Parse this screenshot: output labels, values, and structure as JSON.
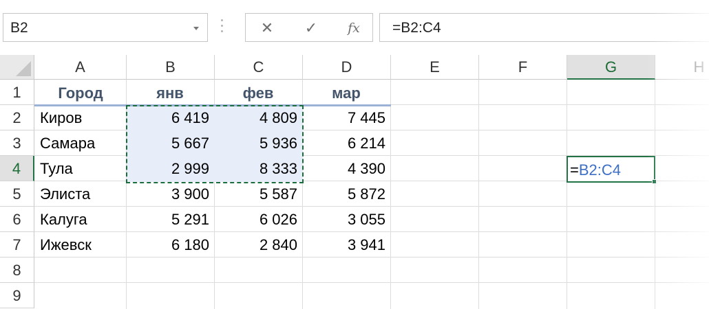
{
  "name_box": {
    "value": "B2"
  },
  "formula_bar": {
    "cancel_glyph": "✕",
    "enter_glyph": "✓",
    "fx_label": "fx",
    "value": "=B2:C4"
  },
  "columns": [
    "A",
    "B",
    "C",
    "D",
    "E",
    "F",
    "G",
    "H"
  ],
  "rows": [
    "1",
    "2",
    "3",
    "4",
    "5",
    "6",
    "7",
    "8",
    "9"
  ],
  "table": {
    "headers": [
      "Город",
      "янв",
      "фев",
      "мар"
    ],
    "rows": [
      {
        "city": "Киров",
        "jan": "6 419",
        "feb": "4 809",
        "mar": "7 445"
      },
      {
        "city": "Самара",
        "jan": "5 667",
        "feb": "5 936",
        "mar": "6 214"
      },
      {
        "city": "Тула",
        "jan": "2 999",
        "feb": "8 333",
        "mar": "4 390"
      },
      {
        "city": "Элиста",
        "jan": "3 900",
        "feb": "5 587",
        "mar": "5 872"
      },
      {
        "city": "Калуга",
        "jan": "5 291",
        "feb": "6 026",
        "mar": "3 055"
      },
      {
        "city": "Ижевск",
        "jan": "6 180",
        "feb": "2 840",
        "mar": "3 941"
      }
    ]
  },
  "edit_cell": {
    "address": "G4",
    "equals": "=",
    "reference": "B2:C4"
  },
  "colors": {
    "accent": "#217346",
    "range_fill": "#e8eef9",
    "reference_text": "#3d6fc7",
    "header_text": "#44546a"
  }
}
